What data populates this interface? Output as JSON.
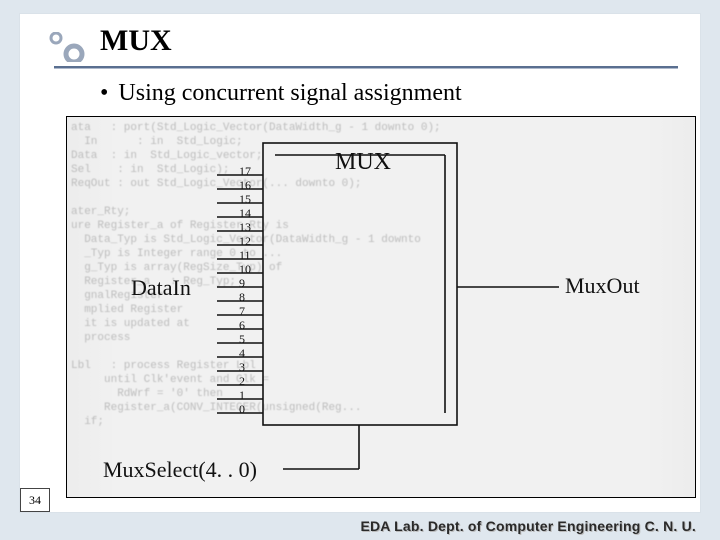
{
  "header": {
    "title": "MUX"
  },
  "bullet": {
    "text": "Using concurrent signal assignment"
  },
  "figure": {
    "mux_label": "MUX",
    "datain_label": "DataIn",
    "muxout_label": "MuxOut",
    "muxselect_label": "MuxSelect(4. . 0)",
    "input_numbers": [
      "17",
      "16",
      "15",
      "14",
      "13",
      "12",
      "11",
      "10",
      "9",
      "8",
      "7",
      "6",
      "5",
      "4",
      "3",
      "2",
      "1",
      "0"
    ],
    "ghost_code": "ata   : port(Std_Logic_Vector(DataWidth_g - 1 downto 0);\n  In      : in  Std_Logic;\nData  : in  Std_Logic_vector;\nSel    : in  Std_Logic);\nReqOut : out Std_Logic_Vector(... downto 0);\n\nater_Rty;\nure Register_a of Register_Rty is\n  Data_Typ is Std_Logic_Vector(DataWidth_g - 1 downto\n  _Typ is Integer range 0 to ...\n  g_Typ is array(RegSize_Typ) of\n  Register_a   : Reg_Typ;\n  gnalRegister\n  mplied Register\n  it is updated at\n  process\n\nLbl   : process Register Lbl\n     until Clk'event and Clk =\n       RdWrf = '0' then\n     Register_a(CONV_INTEGER(unsigned(Reg...\n  if;"
  },
  "page": {
    "number": "34"
  },
  "footer": {
    "text": "EDA Lab. Dept. of Computer Engineering C. N. U."
  },
  "chart_data": {
    "type": "diagram",
    "title": "MUX",
    "component": "Multiplexer",
    "inputs": {
      "DataIn": {
        "width": 18,
        "lines": [
          17,
          16,
          15,
          14,
          13,
          12,
          11,
          10,
          9,
          8,
          7,
          6,
          5,
          4,
          3,
          2,
          1,
          0
        ]
      },
      "MuxSelect": {
        "range": "(4..0)",
        "width": 5
      }
    },
    "outputs": {
      "MuxOut": {
        "width": 1
      }
    },
    "annotations": [
      "Using concurrent signal assignment"
    ]
  }
}
